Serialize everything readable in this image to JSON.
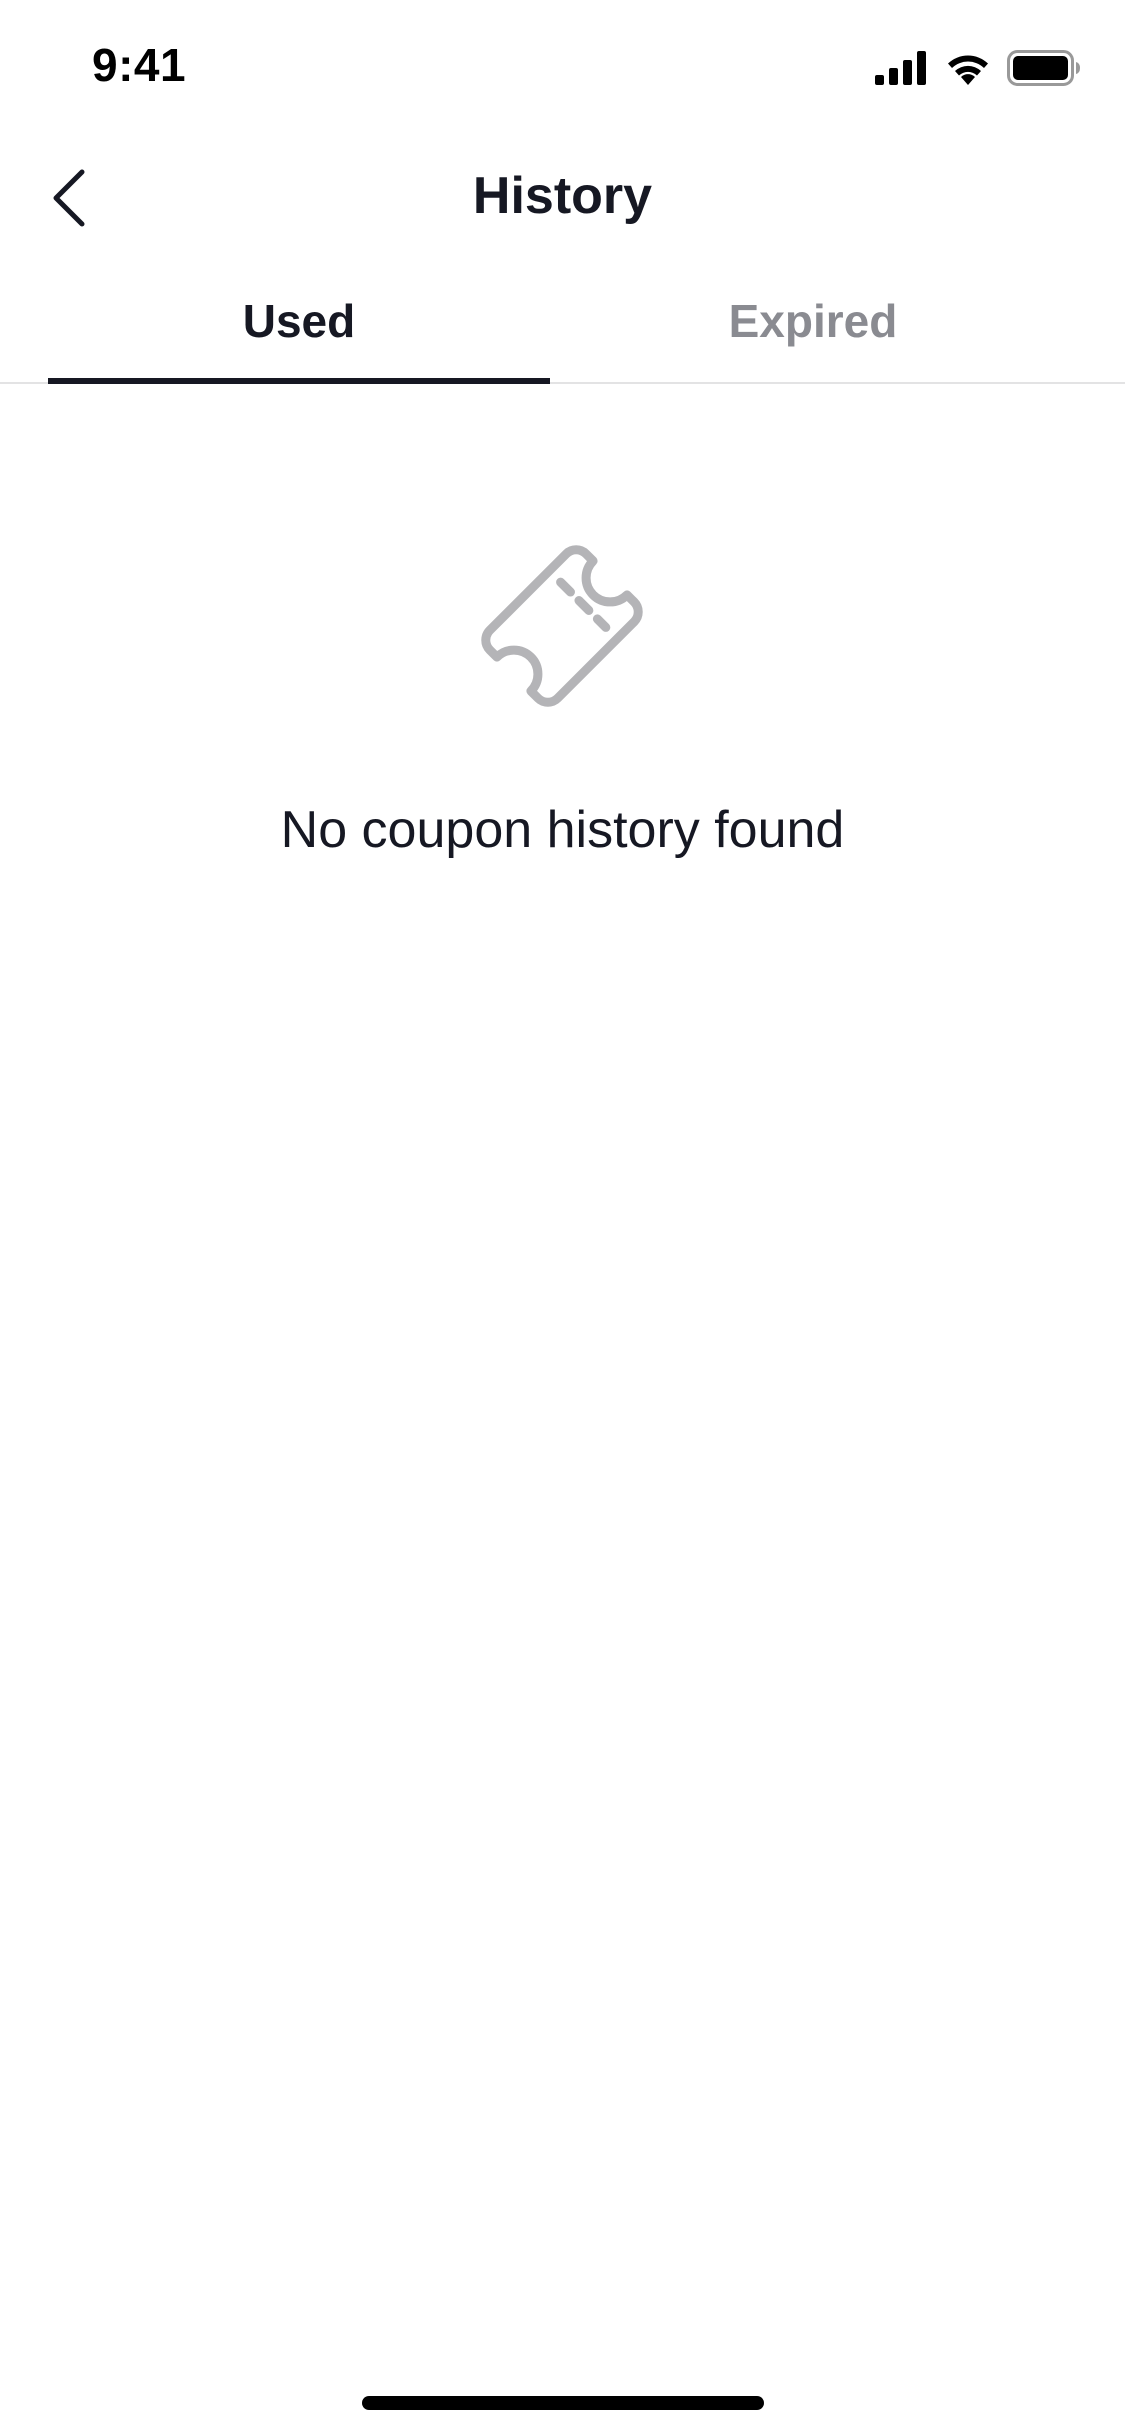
{
  "status_bar": {
    "time": "9:41",
    "icons": [
      "cellular-signal-icon",
      "wifi-icon",
      "battery-icon"
    ]
  },
  "nav": {
    "back_icon": "chevron-left-icon",
    "title": "History"
  },
  "tabs": [
    {
      "label": "Used",
      "selected": true
    },
    {
      "label": "Expired",
      "selected": false
    }
  ],
  "empty_state": {
    "icon": "coupon-ticket-icon",
    "message": "No coupon history found"
  },
  "colors": {
    "text_primary": "#161823",
    "text_secondary": "#8a8b91",
    "divider": "#e3e3e4",
    "icon_gray": "#b4b4b7",
    "background": "#ffffff"
  }
}
